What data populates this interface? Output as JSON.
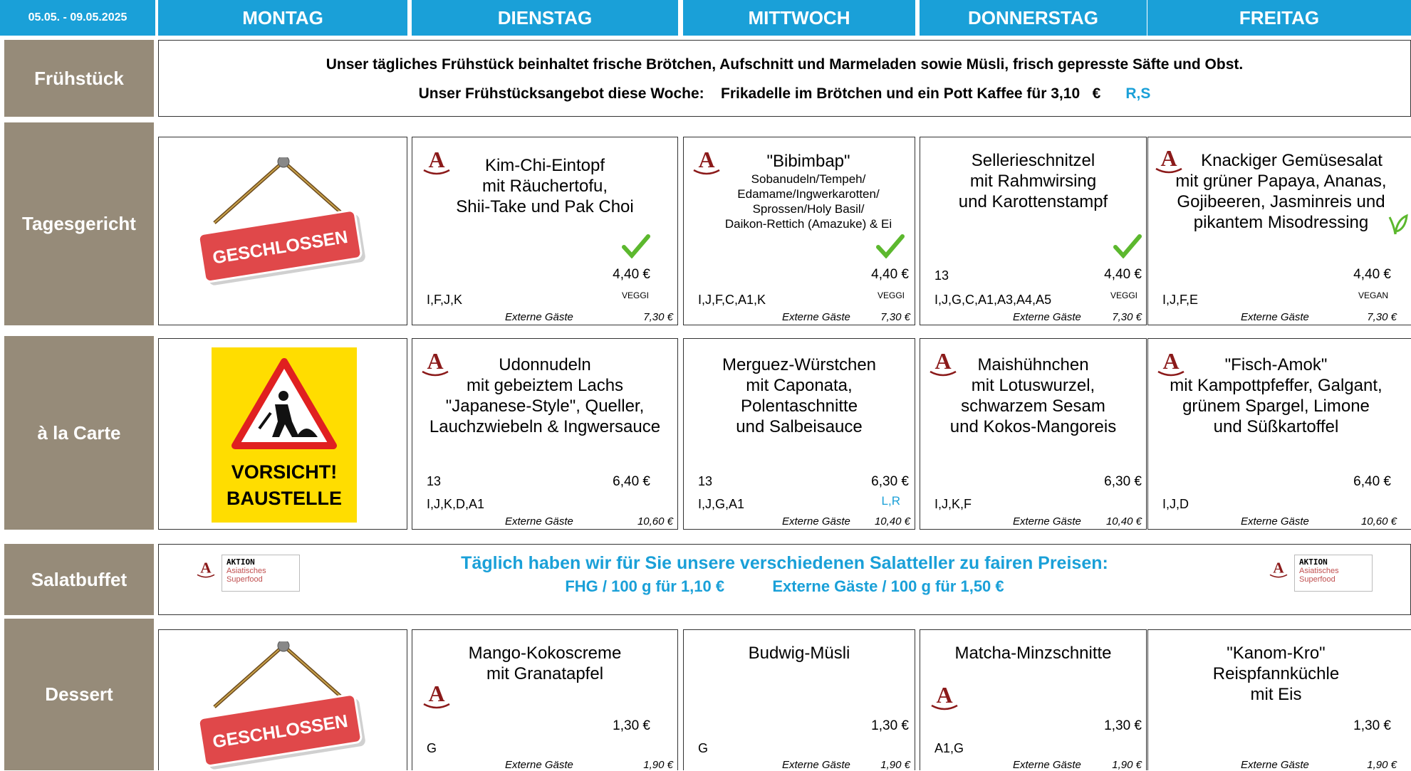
{
  "header": {
    "date_range": "05.05. - 09.05.2025",
    "days": [
      "MONTAG",
      "DIENSTAG",
      "MITTWOCH",
      "DONNERSTAG",
      "FREITAG"
    ]
  },
  "rows": {
    "breakfast": "Frühstück",
    "daily": "Tagesgericht",
    "alacarte": "à la Carte",
    "salad": "Salatbuffet",
    "dessert": "Dessert"
  },
  "breakfast": {
    "line1": "Unser tägliches Frühstück beinhaltet frische Brötchen, Aufschnitt und Marmeladen sowie Müsli, frisch gepresste Säfte und Obst.",
    "offer_label": "Unser Frühstücksangebot diese Woche:",
    "offer_text": "Frikadelle im Brötchen und ein Pott Kaffee für",
    "offer_price": "3,10",
    "offer_currency": "€",
    "offer_allergens": "R,S"
  },
  "signs": {
    "closed": "GESCHLOSSEN",
    "warning_line1": "VORSICHT!",
    "warning_line2": "BAUSTELLE"
  },
  "badge": {
    "letter": "A"
  },
  "ext_label": "Externe Gäste",
  "daily": [
    {
      "lines": [
        "Kim-Chi-Eintopf",
        "mit Räuchertofu,",
        "Shii-Take und Pak Choi"
      ],
      "price": "4,40 €",
      "tag": "VEGGI",
      "num": "",
      "allergens": "I,F,J,K",
      "ext_price": "7,30 €"
    },
    {
      "lines": [
        "\"Bibimbap\"",
        "Sobanudeln/Tempeh/",
        "Edamame/Ingwerkarotten/",
        "Sprossen/Holy Basil/",
        "Daikon-Rettich (Amazuke) & Ei"
      ],
      "price": "4,40 €",
      "tag": "VEGGI",
      "num": "",
      "allergens": "I,J,F,C,A1,K",
      "ext_price": "7,30 €"
    },
    {
      "lines": [
        "Sellerieschnitzel",
        "mit Rahmwirsing",
        "und Karottenstampf"
      ],
      "price": "4,40 €",
      "tag": "VEGGI",
      "num": "13",
      "allergens": "I,J,G,C,A1,A3,A4,A5",
      "ext_price": "7,30 €"
    },
    {
      "lines": [
        "Knackiger Gemüsesalat",
        "mit grüner Papaya, Ananas,",
        "Gojibeeren, Jasminreis und",
        "pikantem Misodressing"
      ],
      "price": "4,40 €",
      "tag": "VEGAN",
      "num": "",
      "allergens": "I,J,F,E",
      "ext_price": "7,30 €"
    }
  ],
  "alacarte": [
    {
      "lines": [
        "Udonnudeln",
        "mit gebeiztem Lachs",
        "\"Japanese-Style\", Queller,",
        "Lauchzwiebeln & Ingwersauce"
      ],
      "price": "6,40 €",
      "num": "13",
      "allergens": "I,J,K,D,A1",
      "extra": "",
      "ext_price": "10,60 €"
    },
    {
      "lines": [
        "Merguez-Würstchen",
        "mit Caponata,",
        "Polentaschnitte",
        "und Salbeisauce"
      ],
      "price": "6,30 €",
      "num": "13",
      "allergens": "I,J,G,A1",
      "extra": "L,R",
      "ext_price": "10,40 €"
    },
    {
      "lines": [
        "Maishühnchen",
        "mit Lotuswurzel,",
        "schwarzem Sesam",
        "und Kokos-Mangoreis"
      ],
      "price": "6,30 €",
      "num": "",
      "allergens": "I,J,K,F",
      "extra": "",
      "ext_price": "10,40 €"
    },
    {
      "lines": [
        "\"Fisch-Amok\"",
        "mit Kampottpfeffer, Galgant,",
        "grünem Spargel, Limone",
        "und Süßkartoffel"
      ],
      "price": "6,40 €",
      "num": "",
      "allergens": "I,J,D",
      "extra": "",
      "ext_price": "10,60 €"
    }
  ],
  "salad": {
    "line1": "Täglich haben wir für Sie unsere verschiedenen Salatteller zu fairen Preisen:",
    "line2a": "FHG / 100 g für 1,10 €",
    "line2b": "Externe Gäste / 100 g für 1,50 €",
    "aktion": {
      "title": "AKTION",
      "sub1": "Asiatisches",
      "sub2": "Superfood"
    }
  },
  "dessert": [
    {
      "lines": [
        "Mango-Kokoscreme",
        "mit Granatapfel"
      ],
      "price": "1,30 €",
      "allergens": "G",
      "ext_price": "1,90 €"
    },
    {
      "lines": [
        "Budwig-Müsli"
      ],
      "price": "1,30 €",
      "allergens": "G",
      "ext_price": "1,90 €"
    },
    {
      "lines": [
        "Matcha-Minzschnitte"
      ],
      "price": "1,30 €",
      "allergens": "A1,G",
      "ext_price": "1,90 €"
    },
    {
      "lines": [
        "\"Kanom-Kro\"",
        "Reispfannküchle",
        "mit Eis"
      ],
      "price": "1,30 €",
      "allergens": "",
      "ext_price": "1,90 €"
    }
  ],
  "colors": {
    "header_blue": "#1aa0d8",
    "row_label": "#968b79",
    "badge_red": "#8b1a1a",
    "check_green": "#5cb82e",
    "sign_red": "#e0484a",
    "warning_yellow": "#ffdd00"
  }
}
